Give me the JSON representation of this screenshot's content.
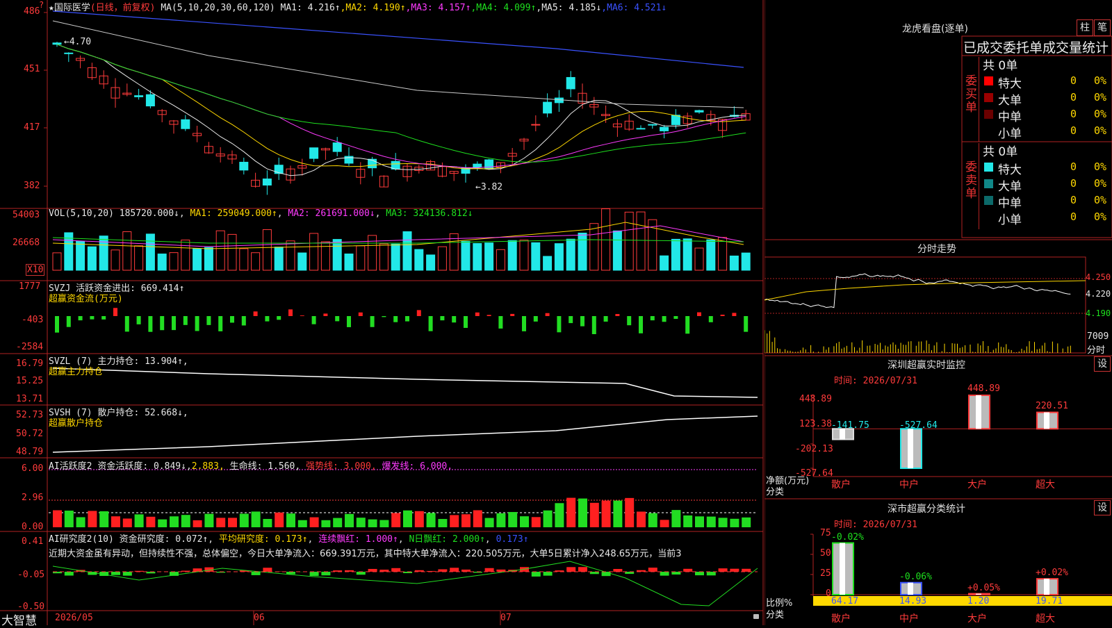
{
  "main": {
    "kline": {
      "title": "★国际医学",
      "period": "(日线，前复权)",
      "ma_label": "MA(5,10,20,30,60,120)",
      "ma": [
        {
          "label": "MA1: 4.216↑",
          "color": "#e8e8e8"
        },
        {
          "label": "MA2: 4.190↑",
          "color": "#ffd800"
        },
        {
          "label": "MA3: 4.157↑",
          "color": "#ff3bff"
        },
        {
          "label": "MA4: 4.099↑",
          "color": "#1ee01e"
        },
        {
          "label": "MA5: 4.185↓",
          "color": "#e8e8e8"
        },
        {
          "label": "MA6: 4.521↓",
          "color": "#3a52ff"
        }
      ],
      "y_ticks": [
        "486",
        "451",
        "417",
        "382"
      ],
      "high_note": "←4.70",
      "low_note": "←3.82"
    },
    "vol": {
      "label": "VOL(5,10,20)",
      "value": "185720.000↓",
      "ma1": "MA1: 259049.000↑",
      "ma2": "MA2: 261691.000↓",
      "ma3": "MA3: 324136.812↓",
      "y_ticks": [
        "54003",
        "26668"
      ],
      "unit": "X10"
    },
    "svzj": {
      "label": "SVZJ",
      "text": "活跃资金进出: 669.414↑",
      "sub": "超赢资金流(万元)",
      "y_ticks": [
        "1777",
        "-403",
        "-2584"
      ]
    },
    "svzl": {
      "label": "SVZL (7)",
      "text": "主力持仓: 13.904↑,",
      "sub": "超赢主力持仓",
      "y_ticks": [
        "16.79",
        "15.25",
        "13.71"
      ]
    },
    "svsh": {
      "label": "SVSH (7)",
      "text": "散户持仓: 52.668↓,",
      "sub": "超赢散户持仓",
      "y_ticks": [
        "52.73",
        "50.72",
        "48.79"
      ]
    },
    "ai1": {
      "label": "AI活跃度2",
      "v1": "资金活跃度: 0.849↓",
      "v2": "2.883,",
      "v3": "生命线: 1.560,",
      "v4": "强势线: 3.000,",
      "v5": "爆发线: 6.000,",
      "y_ticks": [
        "6.00",
        "2.96",
        "0.00"
      ]
    },
    "ai2": {
      "label": "AI研究度2(10)",
      "v1": "资金研究度: 0.072↑",
      "v2": "平均研究度: 0.173↑",
      "v3": "连续飘红: 1.000↑",
      "v4": "N日飘红: 2.000↑",
      "v5": "0.173↑",
      "comment": "近期大资金虽有异动，但持续性不强，总体偏空，今日大单净流入：669.391万元，其中特大单净流入：220.505万元，大单5日累计净入248.65万元，当前3",
      "y_ticks": [
        "0.41",
        "-0.05",
        "-0.50"
      ]
    },
    "xaxis": {
      "brand": "大智慧",
      "labels": [
        "2026/05",
        "06",
        "07"
      ]
    }
  },
  "right": {
    "dragon": {
      "title": "龙虎看盘(逐单)",
      "btn1": "柱",
      "btn2": "笔",
      "stats_title": "已成交委托单成交量统计",
      "buy": {
        "side": "委买单",
        "total": "共 0单",
        "rows": [
          {
            "name": "特大",
            "count": "0",
            "pct": "0%",
            "color": "#ff0000"
          },
          {
            "name": "大单",
            "count": "0",
            "pct": "0%",
            "color": "#990000"
          },
          {
            "name": "中单",
            "count": "0",
            "pct": "0%",
            "color": "#6a0000"
          },
          {
            "name": "小单",
            "count": "0",
            "pct": "0%",
            "color": ""
          }
        ]
      },
      "sell": {
        "side": "委卖单",
        "total": "共 0单",
        "rows": [
          {
            "name": "特大",
            "count": "0",
            "pct": "0%",
            "color": "#22e8e8"
          },
          {
            "name": "大单",
            "count": "0",
            "pct": "0%",
            "color": "#108888"
          },
          {
            "name": "中单",
            "count": "0",
            "pct": "0%",
            "color": "#0c6a6a"
          },
          {
            "name": "小单",
            "count": "0",
            "pct": "0%",
            "color": ""
          }
        ]
      }
    },
    "intraday": {
      "title": "分时走势",
      "prices": [
        "4.250",
        "4.220",
        "4.190"
      ],
      "volume": "7009",
      "unit": "分时"
    },
    "monitor": {
      "title": "深圳超赢实时监控",
      "settings": "设",
      "time": "时间: 2026/07/31",
      "y_ticks": [
        "448.89",
        "123.38",
        "-202.13",
        "-527.64"
      ],
      "ylabel": "净额(万元)",
      "xlabel": "分类",
      "bars": [
        {
          "cat": "散户",
          "value": -141.75,
          "label": "-141.75"
        },
        {
          "cat": "中户",
          "value": -527.64,
          "label": "-527.64"
        },
        {
          "cat": "大户",
          "value": 448.89,
          "label": "448.89"
        },
        {
          "cat": "超大",
          "value": 220.51,
          "label": "220.51"
        }
      ]
    },
    "classify": {
      "title": "深市超赢分类统计",
      "settings": "设",
      "time": "时间: 2026/07/31",
      "y_ticks": [
        "75",
        "50",
        "25",
        "0"
      ],
      "ylabel": "比例%",
      "xlabel": "分类",
      "bars": [
        {
          "cat": "散户",
          "value": 64.17,
          "label": "64.17",
          "change": "-0.02%"
        },
        {
          "cat": "中户",
          "value": 14.93,
          "label": "14.93",
          "change": "-0.06%"
        },
        {
          "cat": "大户",
          "value": 1.2,
          "label": "1.20",
          "change": "+0.05%"
        },
        {
          "cat": "超大",
          "value": 19.71,
          "label": "19.71",
          "change": "+0.02%"
        }
      ]
    }
  },
  "chart_data": [
    {
      "type": "bar",
      "title": "深圳超赢实时监控",
      "categories": [
        "散户",
        "中户",
        "大户",
        "超大"
      ],
      "values": [
        -141.75,
        -527.64,
        448.89,
        220.51
      ],
      "ylabel": "净额(万元)",
      "xlabel": "分类",
      "ylim": [
        -527.64,
        448.89
      ]
    },
    {
      "type": "bar",
      "title": "深市超赢分类统计",
      "categories": [
        "散户",
        "中户",
        "大户",
        "超大"
      ],
      "values": [
        64.17,
        14.93,
        1.2,
        19.71
      ],
      "ylabel": "比例%",
      "xlabel": "分类",
      "ylim": [
        0,
        75
      ]
    }
  ],
  "colors": {
    "up": "#ff3b3b",
    "down": "#22e8e8",
    "grid": "#b22222",
    "bg": "#000000"
  }
}
